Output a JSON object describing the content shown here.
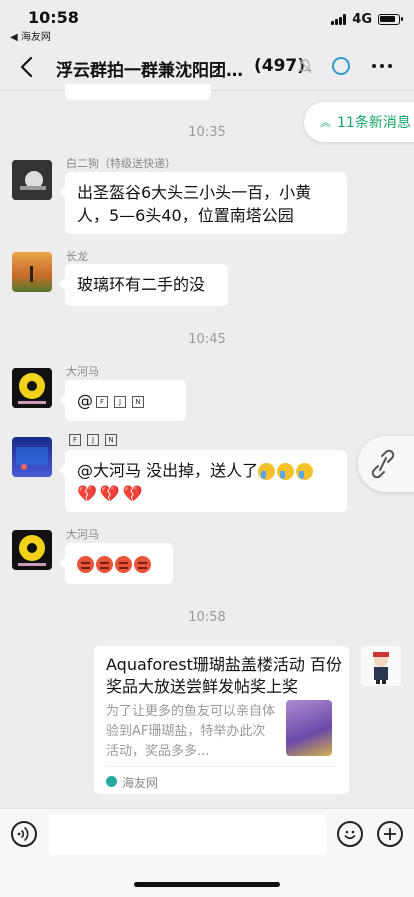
{
  "status": {
    "time": "10:58",
    "back_app": "◀ 海友网",
    "network": "4G"
  },
  "nav": {
    "title": "浮云群拍一群兼沈阳团…",
    "count": "(497)"
  },
  "new_messages": "11条新消息",
  "messages": {
    "t1": "10:35",
    "m1": {
      "sender": "白二狗（特级送快递）",
      "text": "出圣盔谷6大头三小头一百，小黄人，5—6头40，位置南塔公园"
    },
    "m2": {
      "sender": "长龙",
      "text": "玻璃环有二手的没"
    },
    "t2": "10:45",
    "m3": {
      "sender": "大河马",
      "at": "@",
      "boxes": [
        "F",
        "J",
        "N"
      ]
    },
    "m4": {
      "text": "@大河马 没出掉，送人了"
    },
    "m5": {
      "sender": "大河马"
    },
    "t3": "10:58",
    "card": {
      "title": "Aquaforest珊瑚盐盖楼活动 百份奖品大放送尝鲜发帖奖上奖",
      "desc": "为了让更多的鱼友可以亲自体验到AF珊瑚盐，特举办此次活动，奖品多多...",
      "source": "海友网"
    }
  },
  "colors": {
    "accent_green": "#17a86b",
    "link_blue": "#2f9bd6",
    "bg": "#ededed"
  }
}
